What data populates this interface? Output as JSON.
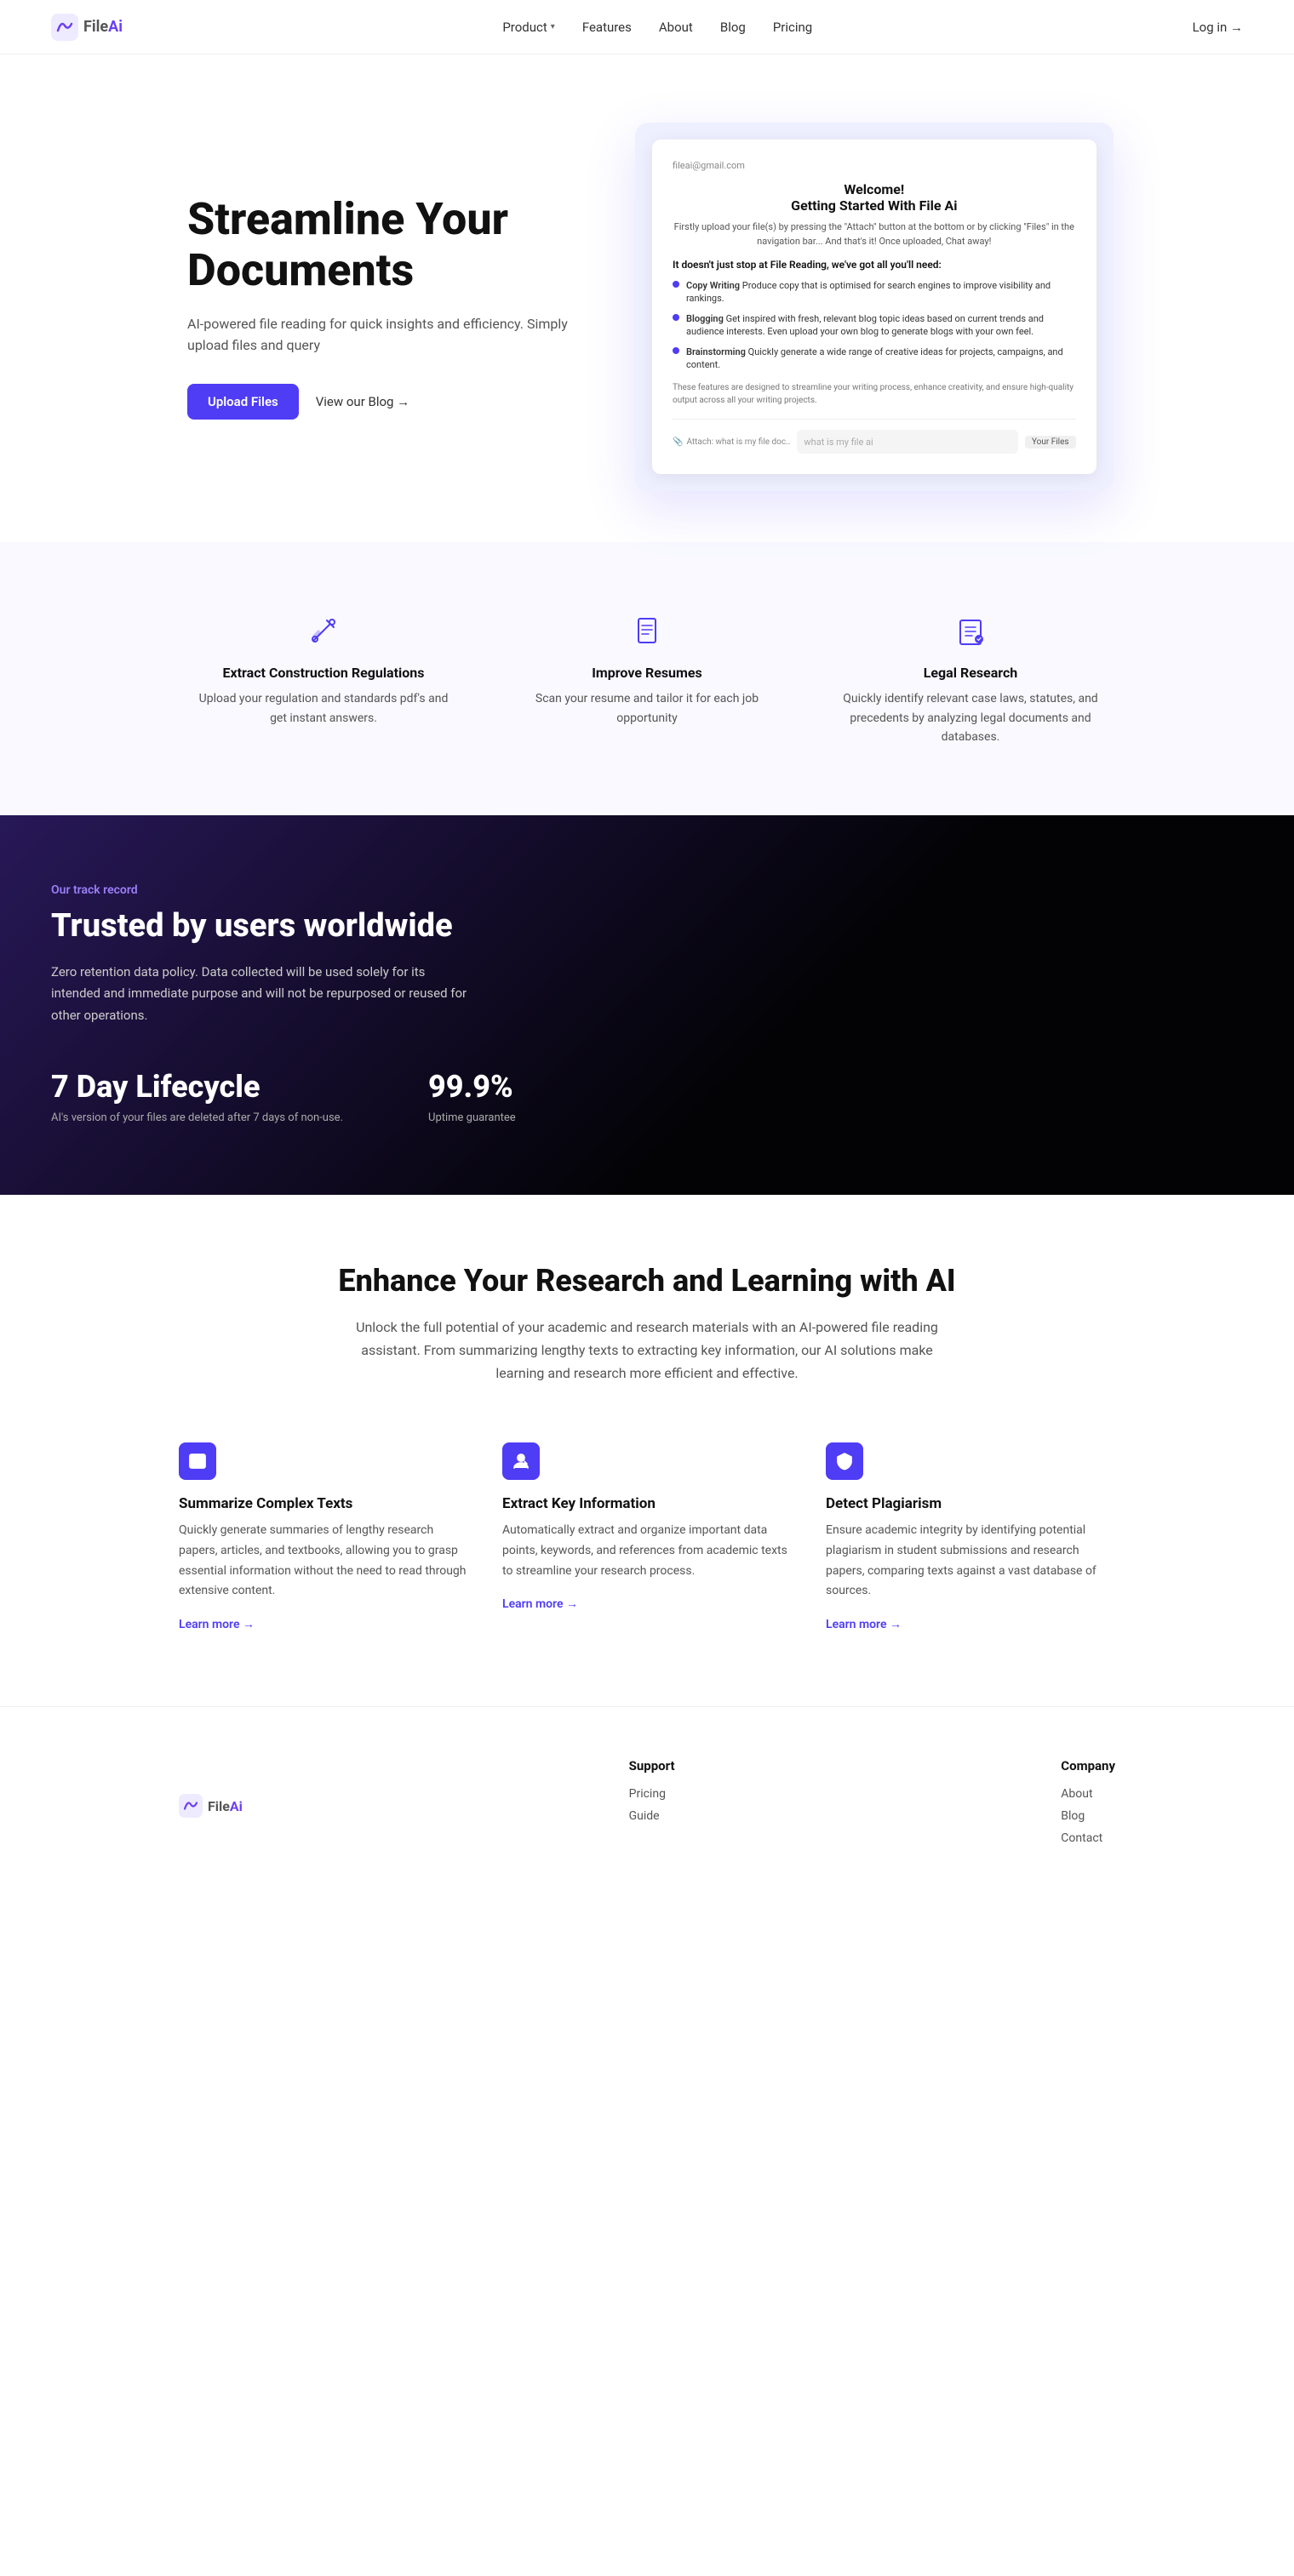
{
  "nav": {
    "logo_file": "File",
    "logo_ai": "Ai",
    "links": [
      {
        "label": "Product",
        "has_dropdown": true
      },
      {
        "label": "Features",
        "has_dropdown": false
      },
      {
        "label": "About",
        "has_dropdown": false
      },
      {
        "label": "Blog",
        "has_dropdown": false
      },
      {
        "label": "Pricing",
        "has_dropdown": false
      }
    ],
    "login_label": "Log in →"
  },
  "hero": {
    "title": "Streamline Your Documents",
    "subtitle": "AI-powered file reading for quick insights and efficiency. Simply upload files and query",
    "cta_primary": "Upload Files",
    "cta_secondary": "View our Blog →",
    "screenshot": {
      "email": "fileai@gmail.com",
      "welcome": "Welcome!",
      "heading": "Getting Started With File Ai",
      "description": "Firstly upload your file(s) by pressing the \"Attach\" button at the bottom or by clicking \"Files\" in the navigation bar... And that's it! Once uploaded, Chat away!",
      "subheading": "It doesn't just stop at File Reading, we've got all you'll need:",
      "items": [
        {
          "title": "Copy Writing",
          "desc": "Produce copy that is optimised for search engines to improve visibility and rankings."
        },
        {
          "title": "Blogging",
          "desc": "Get inspired with fresh, relevant blog topic ideas based on current trends and audience interests. Even upload your own blog to generate blogs with your own feel."
        },
        {
          "title": "Brainstorming",
          "desc": "Quickly generate a wide range of creative ideas for projects, campaigns, and content."
        }
      ],
      "footer_note": "These features are designed to streamline your writing process, enhance creativity, and ensure high-quality output across all your writing projects.",
      "input_placeholder": "what is my file ai",
      "attach_label": "Attach: what is my file doc..",
      "files_label": "Your Files"
    }
  },
  "features": {
    "items": [
      {
        "title": "Extract Construction Regulations",
        "desc": "Upload your regulation and standards pdf's and get instant answers."
      },
      {
        "title": "Improve Resumes",
        "desc": "Scan your resume and tailor it for each job opportunity"
      },
      {
        "title": "Legal Research",
        "desc": "Quickly identify relevant case laws, statutes, and precedents by analyzing legal documents and databases."
      }
    ]
  },
  "track": {
    "label": "Our track record",
    "title": "Trusted by users worldwide",
    "desc": "Zero retention data policy. Data collected will be used solely for its intended and immediate purpose and will not be repurposed or reused for other operations.",
    "stats": [
      {
        "value": "7 Day Lifecycle",
        "label": "AI's version of your files are deleted after 7 days of non-use."
      },
      {
        "value": "99.9%",
        "label": "Uptime guarantee"
      }
    ]
  },
  "research": {
    "title": "Enhance Your Research and Learning with AI",
    "desc": "Unlock the full potential of your academic and research materials with an AI-powered file reading assistant. From summarizing lengthy texts to extracting key information, our AI solutions make learning and research more efficient and effective.",
    "cards": [
      {
        "title": "Summarize Complex Texts",
        "desc": "Quickly generate summaries of lengthy research papers, articles, and textbooks, allowing you to grasp essential information without the need to read through extensive content.",
        "learn_more": "Learn more →"
      },
      {
        "title": "Extract Key Information",
        "desc": "Automatically extract and organize important data points, keywords, and references from academic texts to streamline your research process.",
        "learn_more": "Learn more →"
      },
      {
        "title": "Detect Plagiarism",
        "desc": "Ensure academic integrity by identifying potential plagiarism in student submissions and research papers, comparing texts against a vast database of sources.",
        "learn_more": "Learn more →"
      }
    ]
  },
  "footer": {
    "logo_file": "File",
    "logo_ai": "Ai",
    "cols": [
      {
        "heading": "Support",
        "links": [
          "Pricing",
          "Guide"
        ]
      },
      {
        "heading": "Company",
        "links": [
          "About",
          "Blog",
          "Contact"
        ]
      }
    ]
  }
}
